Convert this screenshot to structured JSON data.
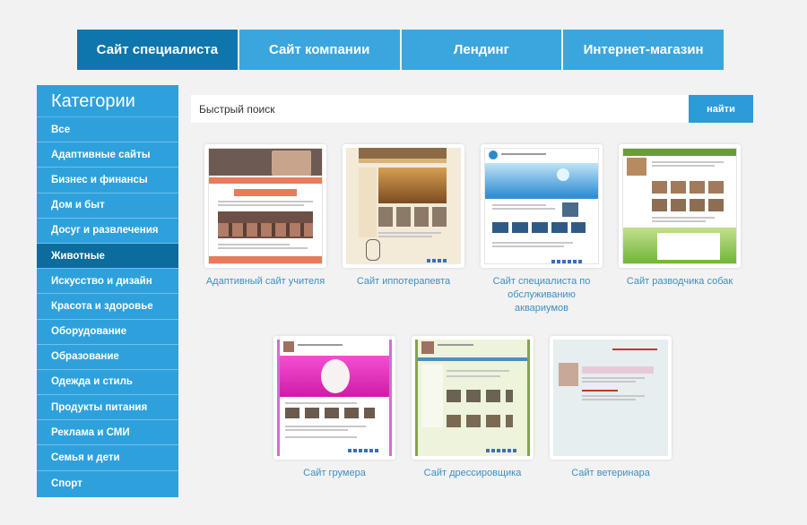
{
  "tabs": [
    {
      "label": "Сайт специалиста",
      "active": true
    },
    {
      "label": "Сайт компании",
      "active": false
    },
    {
      "label": "Лендинг",
      "active": false
    },
    {
      "label": "Интернет-магазин",
      "active": false
    }
  ],
  "sidebar": {
    "title": "Категории",
    "items": [
      {
        "label": "Все"
      },
      {
        "label": "Адаптивные сайты"
      },
      {
        "label": "Бизнес и финансы"
      },
      {
        "label": "Дом и быт"
      },
      {
        "label": "Досуг и развлечения"
      },
      {
        "label": "Животные",
        "active": true
      },
      {
        "label": "Искусство и дизайн"
      },
      {
        "label": "Красота и здоровье"
      },
      {
        "label": "Оборудование"
      },
      {
        "label": "Образование"
      },
      {
        "label": "Одежда и стиль"
      },
      {
        "label": "Продукты питания"
      },
      {
        "label": "Реклама и СМИ"
      },
      {
        "label": "Семья и дети"
      },
      {
        "label": "Спорт"
      }
    ]
  },
  "search": {
    "placeholder": "Быстрый поиск",
    "button_label": "найти"
  },
  "templates": [
    {
      "caption": "Адаптивный сайт учителя"
    },
    {
      "caption": "Сайт иппотерапевта"
    },
    {
      "caption": "Сайт специалиста по обслуживанию аквариумов"
    },
    {
      "caption": "Сайт разводчика собак"
    },
    {
      "caption": "Сайт грумера"
    },
    {
      "caption": "Сайт дрессировщика"
    },
    {
      "caption": "Сайт ветеринара"
    }
  ],
  "colors": {
    "tab_bg": "#3ba6dd",
    "tab_active_bg": "#0f76ad",
    "sidebar_bg": "#2ea1dc",
    "sidebar_active_bg": "#0c6c9e",
    "caption_color": "#3d8fc4"
  }
}
